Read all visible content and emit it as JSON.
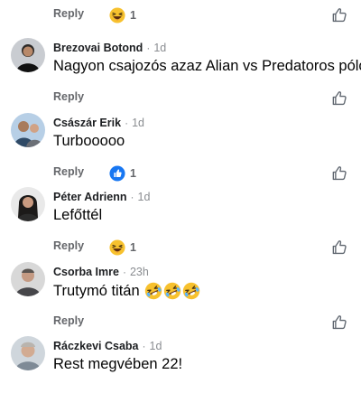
{
  "top_actions": {
    "reply_label": "Reply",
    "reaction": {
      "icon": "laughing-emoji-icon",
      "count": "1"
    }
  },
  "comments": [
    {
      "author": "Brezovai Botond",
      "time": "1d",
      "text": "Nagyon csajozós azaz Alian vs Predatoros póló",
      "reply_label": "Reply",
      "reaction": null
    },
    {
      "author": "Császár Erik",
      "time": "1d",
      "text": "Turbooooo",
      "reply_label": "Reply",
      "reaction": {
        "icon": "like-reaction-icon",
        "count": "1"
      }
    },
    {
      "author": "Péter Adrienn",
      "time": "1d",
      "text": "Lefőttél",
      "reply_label": "Reply",
      "reaction": {
        "icon": "laughing-emoji-icon",
        "count": "1"
      }
    },
    {
      "author": "Csorba Imre",
      "time": "23h",
      "text": "Trutymó titán",
      "emojis": [
        "rolling-laughing-emoji-icon",
        "rolling-laughing-emoji-icon",
        "rolling-laughing-emoji-icon"
      ],
      "reply_label": "Reply",
      "reaction": null
    },
    {
      "author": "Ráczkevi Csaba",
      "time": "1d",
      "text": "Rest megvében 22!",
      "reply_label": "Reply",
      "reaction": null
    }
  ],
  "separator": "·",
  "colors": {
    "text": "#050505",
    "muted": "#65676b",
    "like_blue": "#1877f2",
    "emoji_yellow": "#f7c12e"
  }
}
